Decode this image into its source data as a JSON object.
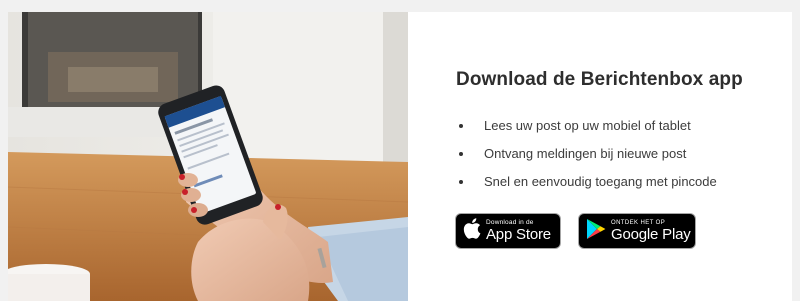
{
  "promo": {
    "title": "Download de Berichtenbox app",
    "bullets": [
      "Lees uw post op uw mobiel of tablet",
      "Ontvang meldingen bij nieuwe post",
      "Snel en eenvoudig toegang met pincode"
    ]
  },
  "badges": {
    "appstore": {
      "small": "Download in de",
      "big": "App Store",
      "icon": "apple-icon"
    },
    "googleplay": {
      "small": "ONTDEK HET OP",
      "big": "Google Play",
      "icon": "google-play-icon"
    }
  },
  "colors": {
    "page_bg": "#f1f1f1",
    "card_bg": "#ffffff",
    "badge_bg": "#000000",
    "phone_header": "#1d4f91"
  }
}
